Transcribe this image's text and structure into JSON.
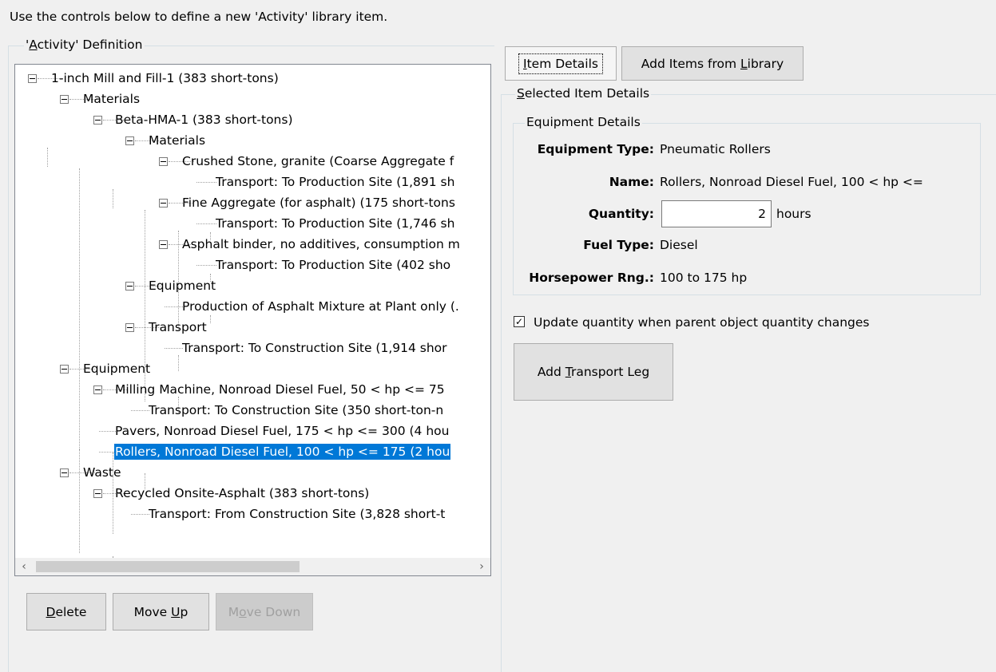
{
  "instruction": "Use the controls below to define a new 'Activity' library item.",
  "definition_group": {
    "legend_prefix": "'",
    "legend_accel": "A",
    "legend_rest": "ctivity' Definition"
  },
  "tree": [
    {
      "text": "1-inch Mill and Fill-1 (383 short-tons)"
    },
    {
      "text": "Materials"
    },
    {
      "text": "Beta-HMA-1 (383 short-tons)"
    },
    {
      "text": "Materials"
    },
    {
      "text": "Crushed Stone, granite (Coarse Aggregate f"
    },
    {
      "text": "Transport: To Production Site (1,891 sh"
    },
    {
      "text": "Fine Aggregate (for asphalt) (175 short-tons"
    },
    {
      "text": "Transport: To Production Site (1,746 sh"
    },
    {
      "text": "Asphalt binder, no additives, consumption m"
    },
    {
      "text": "Transport: To Production Site (402 sho"
    },
    {
      "text": "Equipment"
    },
    {
      "text": "Production of Asphalt Mixture at Plant only (."
    },
    {
      "text": "Transport"
    },
    {
      "text": "Transport: To Construction Site (1,914 shor"
    },
    {
      "text": "Equipment"
    },
    {
      "text": "Milling Machine, Nonroad Diesel Fuel, 50 < hp <= 75"
    },
    {
      "text": "Transport: To Construction Site (350 short-ton-n"
    },
    {
      "text": "Pavers, Nonroad Diesel Fuel, 175 < hp <= 300 (4 hou"
    },
    {
      "text": "Rollers, Nonroad Diesel Fuel, 100 < hp <= 175 (2 hou"
    },
    {
      "text": "Waste"
    },
    {
      "text": "Recycled Onsite-Asphalt (383 short-tons)"
    },
    {
      "text": "Transport: From Construction Site (3,828 short-t"
    }
  ],
  "scroll_left_glyph": "‹",
  "scroll_right_glyph": "›",
  "buttons": {
    "delete": {
      "accel": "D",
      "rest": "elete"
    },
    "move_up": {
      "pre": "Move ",
      "accel": "U",
      "rest": "p"
    },
    "move_down": {
      "pre": "M",
      "accel": "o",
      "rest": "ve Down"
    }
  },
  "tabs": {
    "item_details": {
      "accel": "I",
      "rest": "tem Details"
    },
    "add_from_library": {
      "pre": "Add Items from ",
      "accel": "L",
      "rest": "ibrary"
    }
  },
  "selected_group": {
    "accel": "S",
    "rest": "elected Item Details"
  },
  "equipment": {
    "legend": "Equipment Details",
    "type_label": "Equipment Type:",
    "type_value": "Pneumatic Rollers",
    "name_label": "Name:",
    "name_value": "Rollers, Nonroad Diesel Fuel, 100 < hp <=",
    "quantity_label": "Quantity:",
    "quantity_value": "2",
    "quantity_unit": "hours",
    "fuel_label": "Fuel Type:",
    "fuel_value": "Diesel",
    "hp_label": "Horsepower Rng.:",
    "hp_value": "100 to 175 hp"
  },
  "update_checkbox": {
    "label": "Update quantity when parent object quantity changes",
    "checked_glyph": "✓"
  },
  "add_transport": {
    "pre": "Add ",
    "accel": "T",
    "rest": "ransport Leg"
  }
}
